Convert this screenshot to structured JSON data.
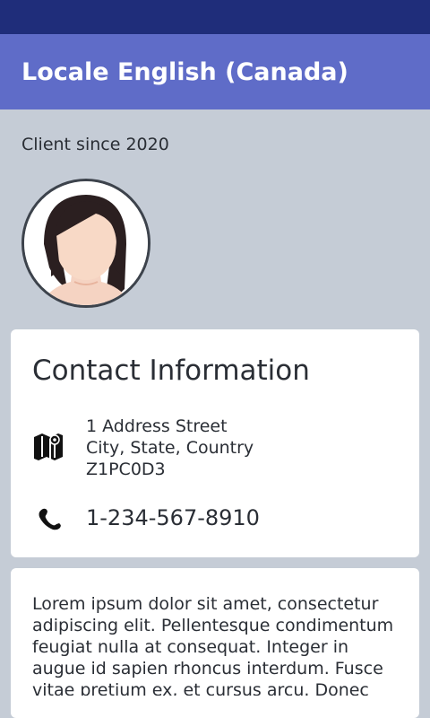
{
  "app_bar": {
    "title": "Locale English (Canada)"
  },
  "profile": {
    "client_since": "Client since 2020"
  },
  "contact": {
    "heading": "Contact Information",
    "address_lines": [
      "1 Address Street",
      "City, State, Country",
      "Z1PC0D3"
    ],
    "address_icon": "map-icon",
    "phone": "1-234-567-8910",
    "phone_icon": "phone-icon"
  },
  "about": {
    "text": "Lorem ipsum dolor sit amet, consectetur adipiscing elit. Pellentesque condimentum feugiat nulla at consequat. Integer in augue id sapien rhoncus interdum. Fusce vitae pretium ex, et cursus arcu. Donec tempor"
  },
  "colors": {
    "status_bar": "#1f2d7a",
    "app_bar": "#5f6cc8",
    "background": "#c5ccd6",
    "card": "#ffffff"
  }
}
